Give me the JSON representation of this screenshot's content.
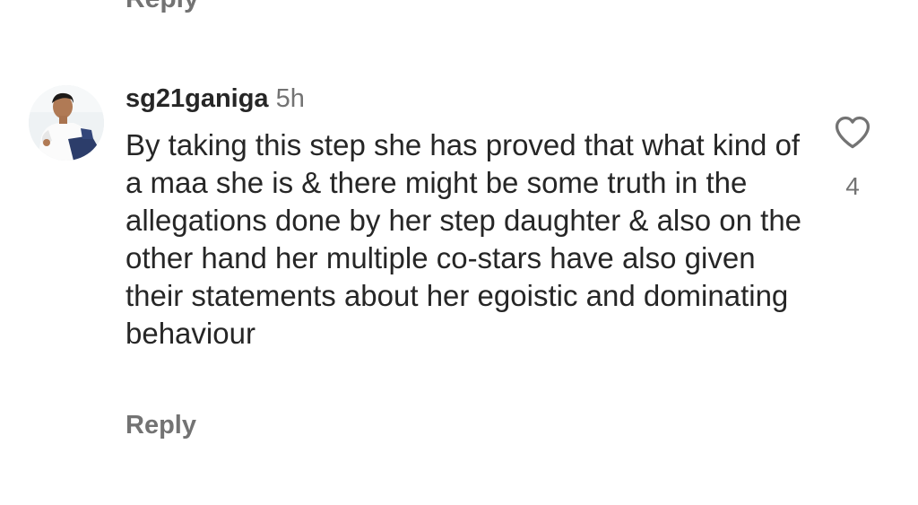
{
  "previous_comment": {
    "reply_label": "Reply"
  },
  "comment": {
    "username": "sg21ganiga",
    "time": "5h",
    "text": "By taking this step she has proved that what kind of a maa she is & there might be some truth in the allegations done by her step daughter & also on the other hand her multiple co-stars have also given their statements about her egoistic and dominating behaviour",
    "reply_label": "Reply",
    "like_count": "4",
    "like_icon": "heart-outline-icon"
  },
  "colors": {
    "primary_text": "#262626",
    "secondary_text": "#737373",
    "background": "#ffffff"
  }
}
